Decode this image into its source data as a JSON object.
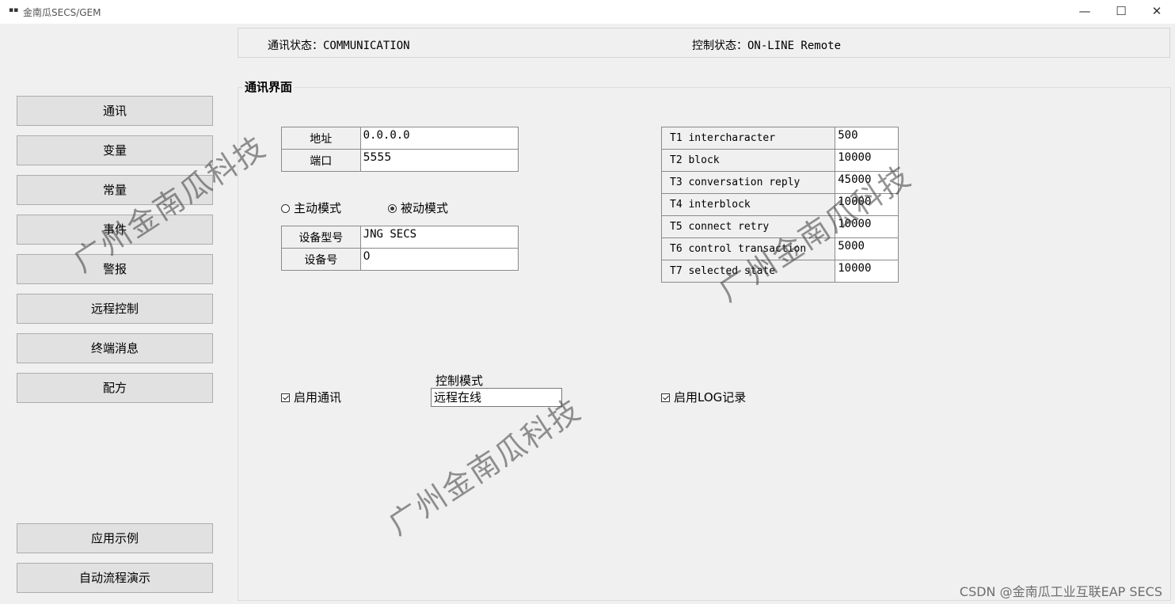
{
  "window": {
    "title": "金南瓜SECS/GEM",
    "icon": "app-icon",
    "minimize": "—",
    "maximize": "☐",
    "close": "✕"
  },
  "status": {
    "comm_label": "通讯状态：",
    "comm_value": "COMMUNICATION",
    "control_label": "控制状态：",
    "control_value": "ON-LINE Remote"
  },
  "nav": {
    "items": [
      "通讯",
      "变量",
      "常量",
      "事件",
      "警报",
      "远程控制",
      "终端消息",
      "配方"
    ],
    "bottom_items": [
      "应用示例",
      "自动流程演示"
    ]
  },
  "panel": {
    "title": "通讯界面",
    "address_label": "地址",
    "address_value": "0.0.0.0",
    "port_label": "端口",
    "port_value": "5555",
    "mode_active": "主动模式",
    "mode_passive": "被动模式",
    "mode_selected": "被动模式",
    "device_model_label": "设备型号",
    "device_model_value": "JNG SECS",
    "device_id_label": "设备号",
    "device_id_value": "0",
    "timers": [
      {
        "label": "T1 intercharacter",
        "value": "500"
      },
      {
        "label": "T2 block",
        "value": "10000"
      },
      {
        "label": "T3 conversation reply",
        "value": "45000"
      },
      {
        "label": "T4 interblock",
        "value": "10000"
      },
      {
        "label": "T5 connect retry",
        "value": "10000"
      },
      {
        "label": "T6 control transaction",
        "value": "5000"
      },
      {
        "label": "T7 selected state",
        "value": "10000"
      }
    ],
    "enable_comm": "启用通讯",
    "enable_comm_checked": true,
    "control_mode_label": "控制模式",
    "control_mode_value": "远程在线",
    "enable_log": "启用LOG记录",
    "enable_log_checked": true
  },
  "watermark": "广州金南瓜科技",
  "footer_credit": "CSDN @金南瓜工业互联EAP SECS"
}
